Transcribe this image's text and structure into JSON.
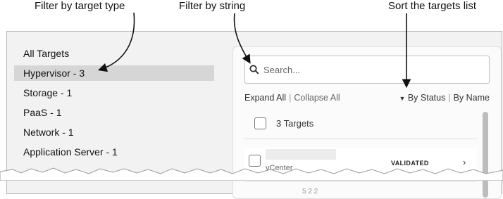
{
  "annotations": {
    "filter_type": "Filter by target type",
    "filter_string": "Filter by string",
    "sort_targets": "Sort the targets list"
  },
  "filters": [
    {
      "label": "All Targets",
      "selected": false
    },
    {
      "label": "Hypervisor - 3",
      "selected": true
    },
    {
      "label": "Storage - 1",
      "selected": false
    },
    {
      "label": "PaaS - 1",
      "selected": false
    },
    {
      "label": "Network - 1",
      "selected": false
    },
    {
      "label": "Application Server - 1",
      "selected": false
    }
  ],
  "search": {
    "placeholder": "Search...",
    "icon": "search-icon"
  },
  "controls": {
    "expand_all": "Expand All",
    "separator": "|",
    "collapse_all": "Collapse All",
    "sort_caret_icon": "caret-down-icon",
    "by_status": "By Status",
    "by_name": "By Name"
  },
  "list": {
    "header": "3 Targets",
    "rows": [
      {
        "subtitle": "vCenter",
        "status": "VALIDATED",
        "chevron_icon": "chevron-right-icon"
      }
    ],
    "partial_row_text": "5 2 2"
  }
}
